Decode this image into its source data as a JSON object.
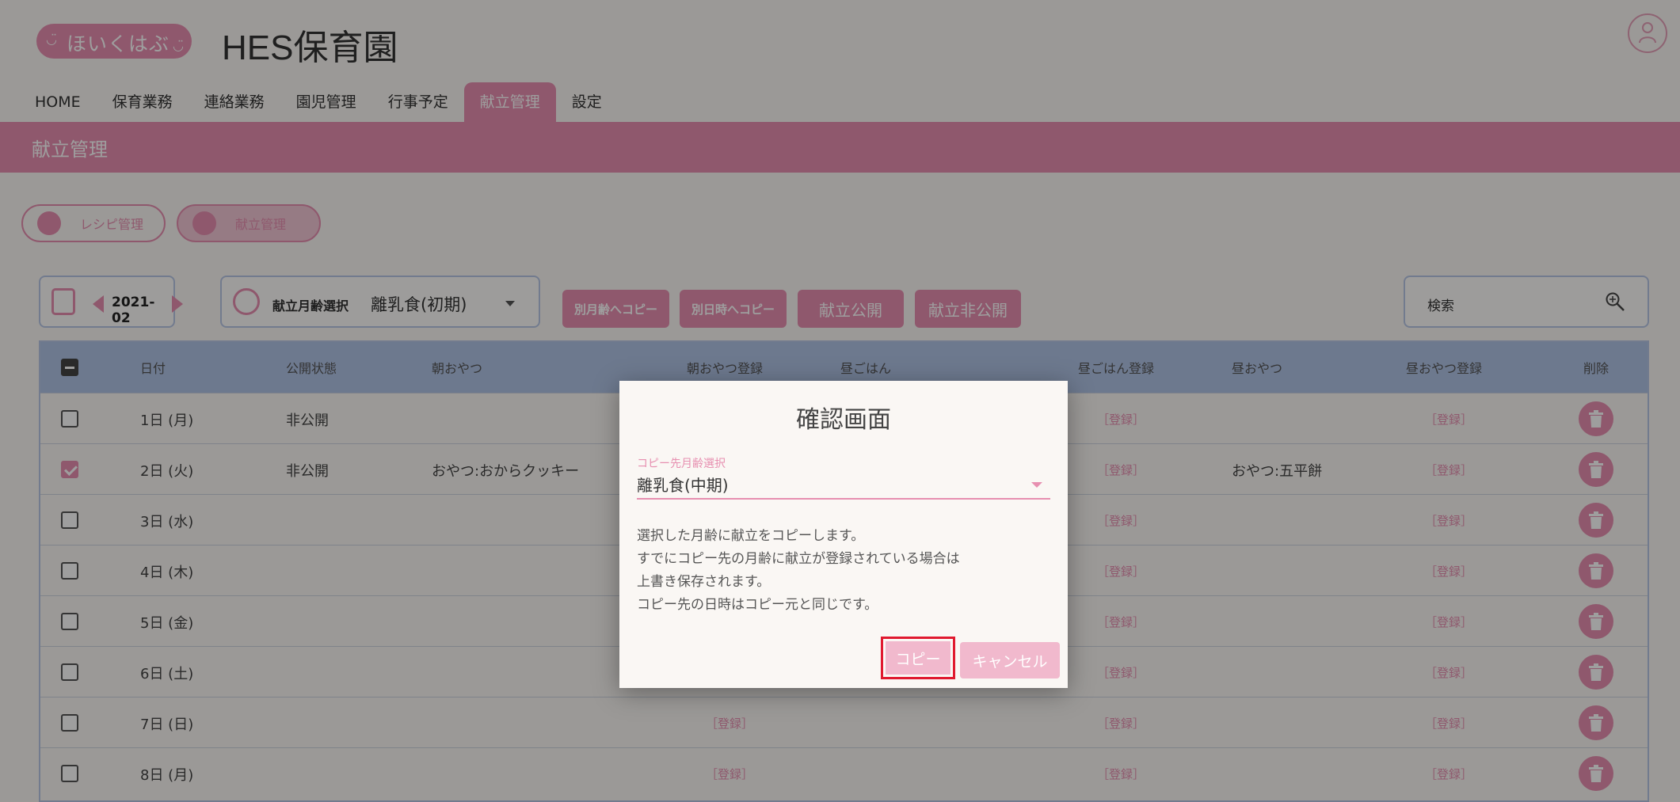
{
  "header": {
    "logo_text": "ほいくはぶ",
    "app_title": "HES保育園"
  },
  "nav": {
    "items": [
      "HOME",
      "保育業務",
      "連絡業務",
      "園児管理",
      "行事予定",
      "献立管理",
      "設定"
    ],
    "active": "献立管理"
  },
  "page_title": "献立管理",
  "sub_nav": {
    "recipe_label": "レシピ管理",
    "menu_label": "献立管理"
  },
  "toolbar": {
    "month": "2021-02",
    "age_label": "献立月齢選択",
    "age_value": "離乳食(初期)",
    "copy_age_button": "別月齢へコピー",
    "copy_date_button": "別日時へコピー",
    "publish_button": "献立公開",
    "unpublish_button": "献立非公開",
    "search_placeholder": "検索"
  },
  "table": {
    "headers": {
      "date": "日付",
      "status": "公開状態",
      "morning_snack": "朝おやつ",
      "morning_snack_reg": "朝おやつ登録",
      "lunch": "昼ごはん",
      "lunch_reg": "昼ごはん登録",
      "afternoon_snack": "昼おやつ",
      "afternoon_snack_reg": "昼おやつ登録",
      "delete": "削除"
    },
    "register_label": "［登録］",
    "rows": [
      {
        "date": "1日 (月)",
        "status": "非公開",
        "morning_snack": "",
        "afternoon_snack": ""
      },
      {
        "date": "2日 (火)",
        "status": "非公開",
        "morning_snack": "おやつ:おからクッキー",
        "afternoon_snack": "おやつ:五平餅"
      },
      {
        "date": "3日 (水)",
        "status": "",
        "morning_snack": "",
        "afternoon_snack": ""
      },
      {
        "date": "4日 (木)",
        "status": "",
        "morning_snack": "",
        "afternoon_snack": ""
      },
      {
        "date": "5日 (金)",
        "status": "",
        "morning_snack": "",
        "afternoon_snack": ""
      },
      {
        "date": "6日 (土)",
        "status": "",
        "morning_snack": "",
        "afternoon_snack": ""
      },
      {
        "date": "7日 (日)",
        "status": "",
        "morning_snack": "",
        "afternoon_snack": ""
      },
      {
        "date": "8日 (月)",
        "status": "",
        "morning_snack": "",
        "afternoon_snack": ""
      }
    ]
  },
  "dialog": {
    "title": "確認画面",
    "select_label": "コピー先月齢選択",
    "select_value": "離乳食(中期)",
    "message_lines": [
      "選択した月齢に献立をコピーします。",
      "すでにコピー先の月齢に献立が登録されている場合は",
      "上書き保存されます。",
      "コピー先の日時はコピー元と同じです。"
    ],
    "copy_button": "コピー",
    "cancel_button": "キャンセル"
  },
  "colors": {
    "accent": "#e78fb0",
    "table_header": "#b0c3e6",
    "highlight": "#e0192f"
  }
}
